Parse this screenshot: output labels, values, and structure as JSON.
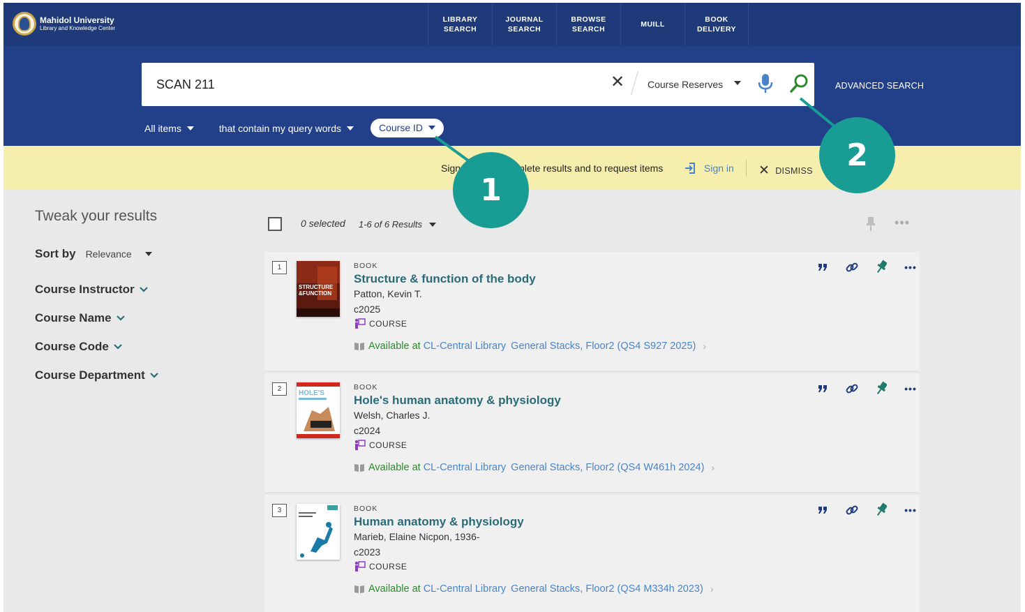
{
  "header": {
    "logo_line1": "Mahidol University",
    "logo_line2": "Library and Knowledge Center",
    "nav": [
      {
        "l1": "LIBRARY",
        "l2": "SEARCH"
      },
      {
        "l1": "JOURNAL",
        "l2": "SEARCH"
      },
      {
        "l1": "BROWSE",
        "l2": "SEARCH"
      },
      {
        "l1": "MUILL",
        "l2": ""
      },
      {
        "l1": "BOOK",
        "l2": "DELIVERY"
      }
    ]
  },
  "search": {
    "query": "SCAN 211",
    "scope": "Course Reserves",
    "advanced": "ADVANCED SEARCH",
    "filters": {
      "items": "All items",
      "match": "that contain my query words",
      "field": "Course ID"
    }
  },
  "notice": {
    "text": "Sign in to get complete results and to request items",
    "signin": "Sign in",
    "dismiss": "DISMISS"
  },
  "sidebar": {
    "title": "Tweak your results",
    "sort_label": "Sort by",
    "sort_value": "Relevance",
    "facets": [
      "Course Instructor",
      "Course Name",
      "Course Code",
      "Course Department"
    ]
  },
  "results_header": {
    "selected": "0 selected",
    "count": "1-6 of 6 Results"
  },
  "results": [
    {
      "num": "1",
      "type": "BOOK",
      "title": "Structure & function of the body",
      "author": "Patton, Kevin T.",
      "year": "c2025",
      "course": "COURSE",
      "avail_prefix": "Available at",
      "library": "CL-Central Library",
      "location": "General Stacks, Floor2 (QS4 S927 2025)"
    },
    {
      "num": "2",
      "type": "BOOK",
      "title": "Hole's human anatomy & physiology",
      "author": "Welsh, Charles J.",
      "year": "c2024",
      "course": "COURSE",
      "avail_prefix": "Available at",
      "library": "CL-Central Library",
      "location": "General Stacks, Floor2 (QS4 W461h 2024)"
    },
    {
      "num": "3",
      "type": "BOOK",
      "title": "Human anatomy & physiology",
      "author": "Marieb, Elaine Nicpon, 1936-",
      "year": "c2023",
      "course": "COURSE",
      "avail_prefix": "Available at",
      "library": "CL-Central Library",
      "location": "General Stacks, Floor2 (QS4 M334h 2023)"
    }
  ],
  "callouts": [
    "1",
    "2"
  ],
  "colors": {
    "nav_bg": "#1e3a78",
    "search_band": "#22408a",
    "notice_bg": "#f5eead",
    "title_teal": "#2a6b78",
    "available_green": "#2c8a2c",
    "link_blue": "#4a84c8",
    "callout_teal": "#199c93"
  }
}
